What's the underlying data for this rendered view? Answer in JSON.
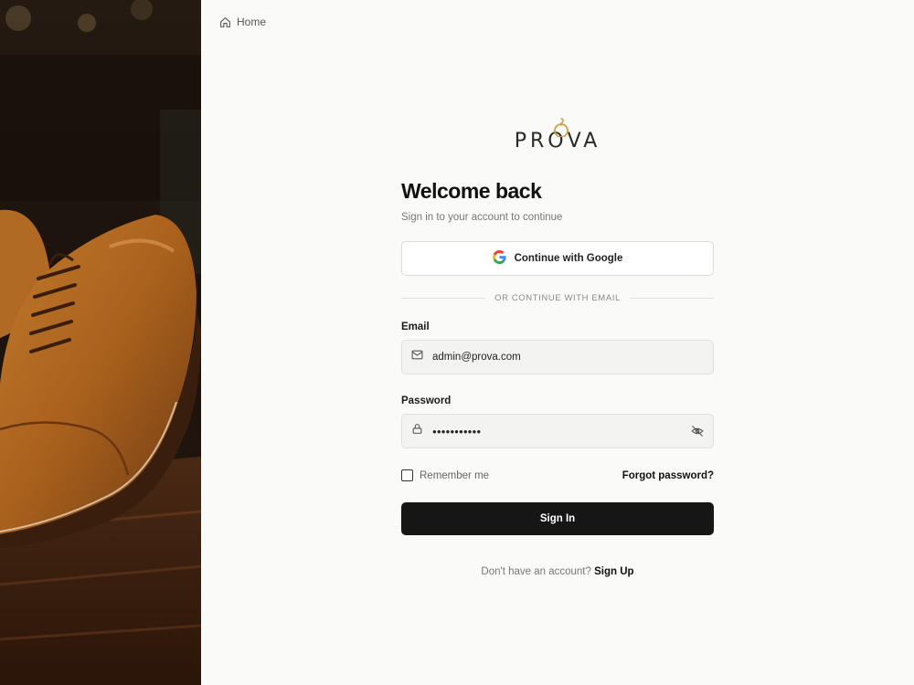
{
  "breadcrumb": {
    "home_label": "Home",
    "home_icon": "home-icon"
  },
  "brand": {
    "name": "PRΟVA",
    "accent_color": "#c9a24a"
  },
  "login": {
    "title": "Welcome back",
    "subtitle": "Sign in to your account to continue",
    "google_label": "Continue with Google",
    "divider_text": "OR CONTINUE WITH EMAIL",
    "email_label": "Email",
    "email_value": "admin@prova.com",
    "password_label": "Password",
    "password_value": "●●●●●●●●●●●",
    "remember_label": "Remember me",
    "remember_checked": false,
    "forgot_label": "Forgot password?",
    "signin_label": "Sign In",
    "signup_prompt": "Don't have an account?",
    "signup_link": "Sign Up"
  },
  "icons": {
    "email": "mail-icon",
    "password": "lock-icon",
    "toggle_visibility": "eye-off-icon",
    "google": "google-icon"
  },
  "colors": {
    "primary_button": "#161616",
    "field_bg": "#f3f3f1",
    "page_bg": "#fafaf8"
  }
}
